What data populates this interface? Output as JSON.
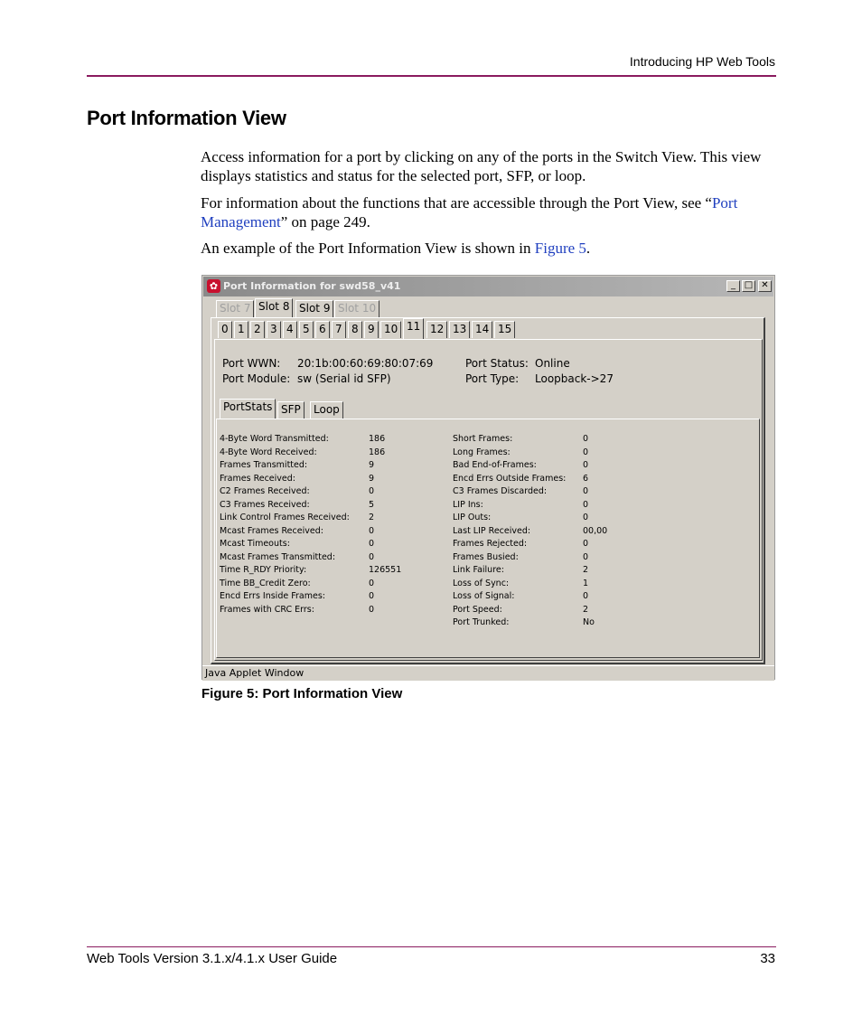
{
  "header": {
    "running_title": "Introducing HP Web Tools"
  },
  "section": {
    "title": "Port Information View",
    "para1": "Access information for a port by clicking on any of the ports in the Switch View. This view displays statistics and status for the selected port, SFP, or loop.",
    "para2_before": "For information about the functions that are accessible through the Port View, see “",
    "para2_link": "Port Management",
    "para2_after": "” on page 249.",
    "para3_before": "An example of the Port Information View is shown in ",
    "para3_link": "Figure 5",
    "para3_after": "."
  },
  "window": {
    "title": "Port Information for swd58_v41",
    "status_bar": "Java Applet Window",
    "slot_tabs": [
      {
        "label": "Slot 7",
        "state": "disabled"
      },
      {
        "label": "Slot 8",
        "state": "active"
      },
      {
        "label": "Slot 9",
        "state": "normal"
      },
      {
        "label": "Slot 10",
        "state": "disabled"
      }
    ],
    "port_tabs": [
      "0",
      "1",
      "2",
      "3",
      "4",
      "5",
      "6",
      "7",
      "8",
      "9",
      "10",
      "11",
      "12",
      "13",
      "14",
      "15"
    ],
    "selected_port": "11",
    "info": {
      "wwn_label": "Port WWN:",
      "wwn_value": "20:1b:00:60:69:80:07:69",
      "module_label": "Port Module:",
      "module_value": "sw (Serial id SFP)",
      "status_label": "Port Status:",
      "status_value": "Online",
      "type_label": "Port Type:",
      "type_value": "Loopback->27"
    },
    "sub_tabs": [
      "PortStats",
      "SFP",
      "Loop"
    ],
    "stats_left": [
      {
        "label": "4-Byte Word Transmitted:",
        "value": "186"
      },
      {
        "label": "4-Byte Word Received:",
        "value": "186"
      },
      {
        "label": "Frames Transmitted:",
        "value": "9"
      },
      {
        "label": "Frames Received:",
        "value": "9"
      },
      {
        "label": "C2 Frames Received:",
        "value": "0"
      },
      {
        "label": "C3 Frames Received:",
        "value": "5"
      },
      {
        "label": "Link Control Frames Received:",
        "value": "2"
      },
      {
        "label": "Mcast Frames Received:",
        "value": "0"
      },
      {
        "label": "Mcast Timeouts:",
        "value": "0"
      },
      {
        "label": "Mcast Frames Transmitted:",
        "value": "0"
      },
      {
        "label": "Time R_RDY Priority:",
        "value": "126551"
      },
      {
        "label": "Time BB_Credit Zero:",
        "value": "0"
      },
      {
        "label": "Encd Errs Inside Frames:",
        "value": "0"
      },
      {
        "label": "Frames with CRC Errs:",
        "value": "0"
      }
    ],
    "stats_right": [
      {
        "label": "Short Frames:",
        "value": "0"
      },
      {
        "label": "Long Frames:",
        "value": "0"
      },
      {
        "label": "Bad End-of-Frames:",
        "value": "0"
      },
      {
        "label": "Encd Errs Outside Frames:",
        "value": "6"
      },
      {
        "label": "C3 Frames Discarded:",
        "value": "0"
      },
      {
        "label": "LIP Ins:",
        "value": "0"
      },
      {
        "label": "LIP Outs:",
        "value": "0"
      },
      {
        "label": "Last LIP Received:",
        "value": "00,00"
      },
      {
        "label": "Frames Rejected:",
        "value": "0"
      },
      {
        "label": "Frames Busied:",
        "value": "0"
      },
      {
        "label": "Link Failure:",
        "value": "2"
      },
      {
        "label": "Loss of Sync:",
        "value": "1"
      },
      {
        "label": "Loss of Signal:",
        "value": "0"
      },
      {
        "label": "Port Speed:",
        "value": "2"
      },
      {
        "label": "Port Trunked:",
        "value": "No"
      }
    ]
  },
  "figure": {
    "caption": "Figure 5:  Port Information View"
  },
  "footer": {
    "doc_title": "Web Tools Version 3.1.x/4.1.x User Guide",
    "page_number": "33"
  }
}
